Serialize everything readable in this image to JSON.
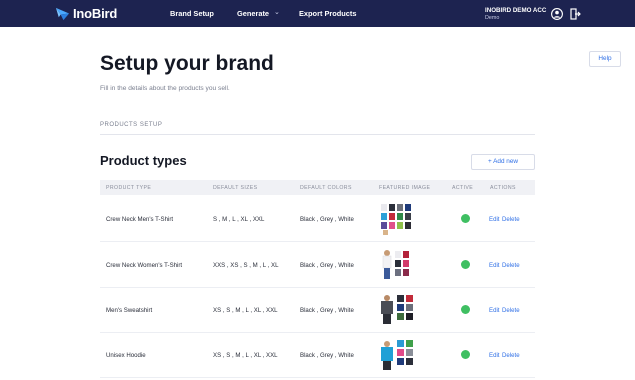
{
  "brand": {
    "name": "InoBird",
    "nav_color": "#1d2350",
    "accent": "#2f6fe6",
    "active_color": "#3fbf62"
  },
  "nav": {
    "items": [
      "Brand Setup",
      "Generate",
      "Export Products"
    ],
    "generate_caret": "⌄"
  },
  "account": {
    "name": "INOBIRD DEMO ACC",
    "sub": "Demo",
    "user_icon": "user-circle-icon",
    "logout_icon": "logout-icon"
  },
  "help_label": "Help",
  "page": {
    "title": "Setup your brand",
    "subtitle": "Fill in the details about the products you sell.",
    "section_label": "PRODUCTS SETUP"
  },
  "product_types": {
    "title": "Product types",
    "add_label": "+ Add new",
    "columns": [
      "PRODUCT TYPE",
      "DEFAULT SIZES",
      "DEFAULT COLORS",
      "FEATURED IMAGE",
      "ACTIVE",
      "ACTIONS"
    ],
    "rows": [
      {
        "type": "Crew Neck Men's T-Shirt",
        "sizes": "S , M , L , XL , XXL",
        "colors": "Black , Grey , White",
        "image": "tshirt-grid",
        "active": true,
        "edit": "Edit",
        "delete": "Delete"
      },
      {
        "type": "Crew Neck Women's T-Shirt",
        "sizes": "XXS , XS , S , M , L , XL",
        "colors": "Black , Grey , White",
        "image": "womens-tshirt",
        "active": true,
        "edit": "Edit",
        "delete": "Delete"
      },
      {
        "type": "Men's Sweatshirt",
        "sizes": "XS , S , M , L , XL , XXL",
        "colors": "Black , Grey , White",
        "image": "sweatshirt-grid",
        "active": true,
        "edit": "Edit",
        "delete": "Delete"
      },
      {
        "type": "Unisex Hoodie",
        "sizes": "XS , S , M , L , XL , XXL",
        "colors": "Black , Grey , White",
        "image": "hoodie-grid",
        "active": true,
        "edit": "Edit",
        "delete": "Delete"
      }
    ]
  }
}
